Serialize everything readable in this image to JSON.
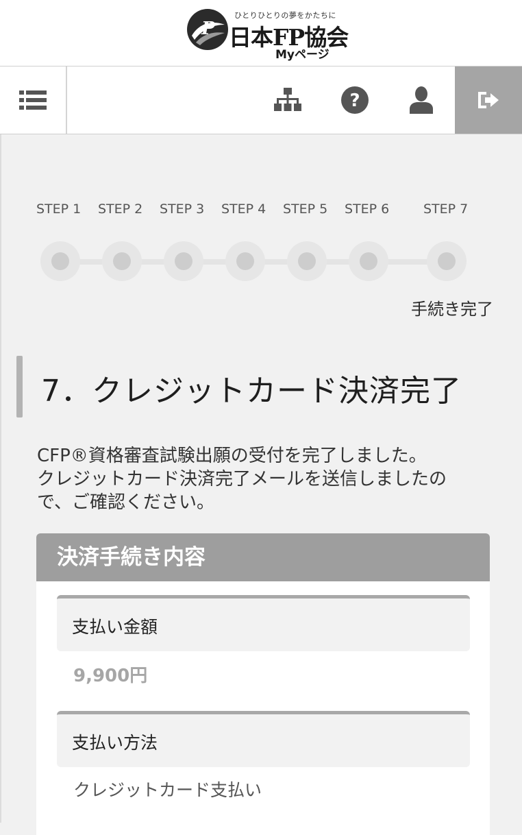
{
  "header": {
    "logo_tagline": "ひとりひとりの夢をかたちに",
    "logo_name": "日本FP協会",
    "logo_sub": "Myページ"
  },
  "nav": {
    "icons": [
      "list-icon",
      "sitemap-icon",
      "help-icon",
      "user-icon",
      "logout-icon"
    ]
  },
  "steps": {
    "labels": [
      "STEP 1",
      "STEP 2",
      "STEP 3",
      "STEP 4",
      "STEP 5",
      "STEP 6",
      "STEP 7"
    ],
    "current_caption": "手続き完了"
  },
  "page": {
    "title": "7．クレジットカード決済完了",
    "message_lines": [
      "CFP®資格審査試験出願の受付を完了しました。",
      "クレジットカード決済完了メールを送信しましたの",
      "で、ご確認ください。"
    ]
  },
  "card": {
    "title": "決済手続き内容",
    "amount_label": "支払い金額",
    "amount_value": "9,900円",
    "method_label": "支払い方法",
    "method_value": "クレジットカード支払い"
  },
  "colors": {
    "header_bg": "#ffffff",
    "page_bg": "#f1f1f1",
    "card_head_bg": "#9e9e9e",
    "logout_bg": "#a5a5a5",
    "icon": "#555555"
  }
}
